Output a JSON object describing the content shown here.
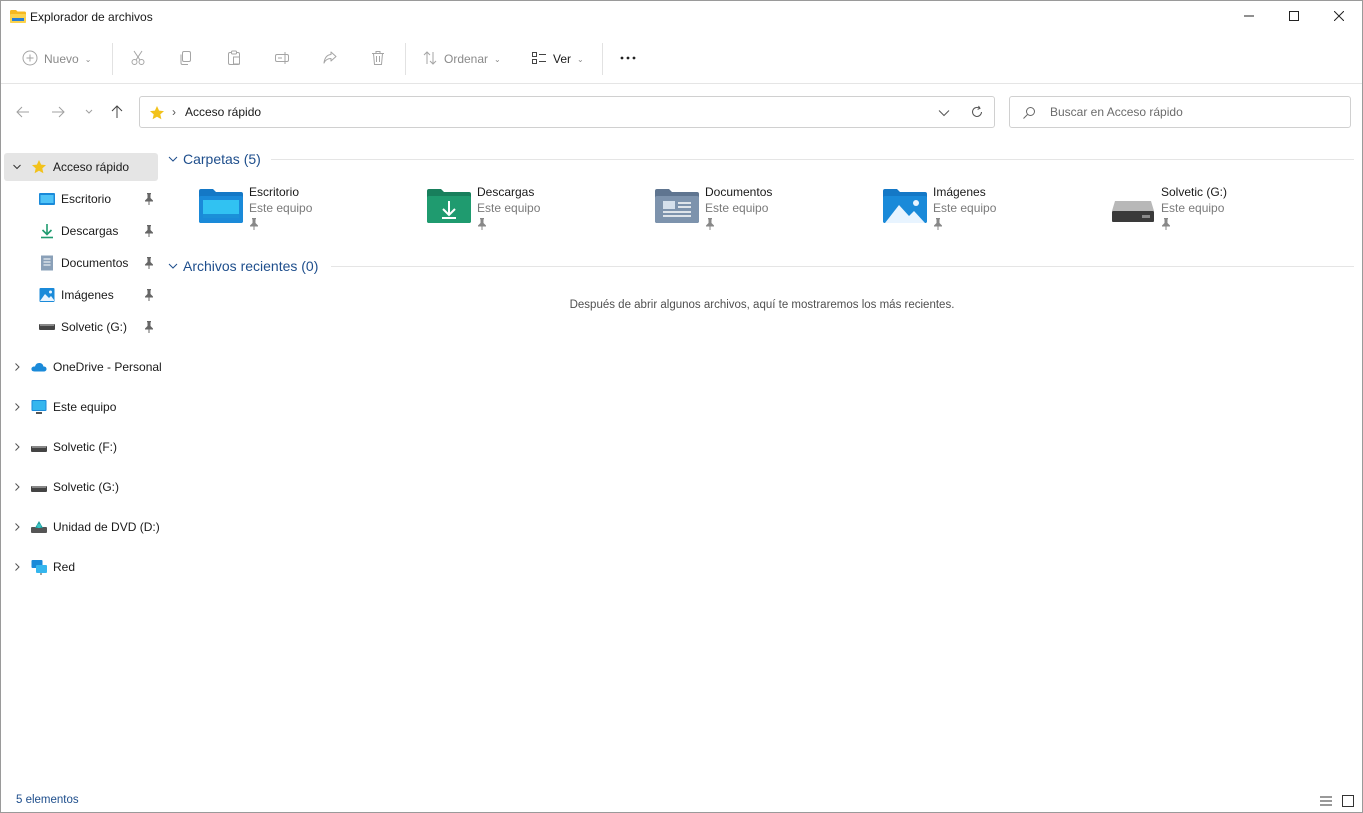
{
  "window": {
    "title": "Explorador de archivos"
  },
  "toolbar": {
    "new_label": "Nuevo",
    "sort_label": "Ordenar",
    "view_label": "Ver"
  },
  "address": {
    "path": "Acceso rápido"
  },
  "search": {
    "placeholder": "Buscar en Acceso rápido"
  },
  "sidebar": {
    "quick_access": "Acceso rápido",
    "pinned": [
      {
        "label": "Escritorio",
        "icon": "desktop-icon"
      },
      {
        "label": "Descargas",
        "icon": "download-icon"
      },
      {
        "label": "Documentos",
        "icon": "document-icon"
      },
      {
        "label": "Imágenes",
        "icon": "pictures-icon"
      },
      {
        "label": "Solvetic (G:)",
        "icon": "drive-icon"
      }
    ],
    "roots": [
      {
        "label": "OneDrive - Personal",
        "icon": "onedrive-icon"
      },
      {
        "label": "Este equipo",
        "icon": "computer-icon"
      },
      {
        "label": "Solvetic (F:)",
        "icon": "drive-icon"
      },
      {
        "label": "Solvetic (G:)",
        "icon": "drive-icon"
      },
      {
        "label": "Unidad de DVD (D:)",
        "icon": "dvd-icon"
      },
      {
        "label": "Red",
        "icon": "network-icon"
      }
    ]
  },
  "content": {
    "folders_header": "Carpetas (5)",
    "recent_header": "Archivos recientes (0)",
    "folders": [
      {
        "name": "Escritorio",
        "location": "Este equipo",
        "icon": "desktop-folder-icon"
      },
      {
        "name": "Descargas",
        "location": "Este equipo",
        "icon": "downloads-folder-icon"
      },
      {
        "name": "Documentos",
        "location": "Este equipo",
        "icon": "documents-folder-icon"
      },
      {
        "name": "Imágenes",
        "location": "Este equipo",
        "icon": "pictures-folder-icon"
      },
      {
        "name": "Solvetic (G:)",
        "location": "Este equipo",
        "icon": "drive-icon"
      }
    ],
    "recent_empty_message": "Después de abrir algunos archivos, aquí te mostraremos los más recientes."
  },
  "status": {
    "count_text": "5 elementos"
  },
  "colors": {
    "accent": "#1e4e8c",
    "folder_blue": "#1a8ad9",
    "folder_green": "#1f9b6f",
    "star_yellow": "#f2c21b"
  }
}
